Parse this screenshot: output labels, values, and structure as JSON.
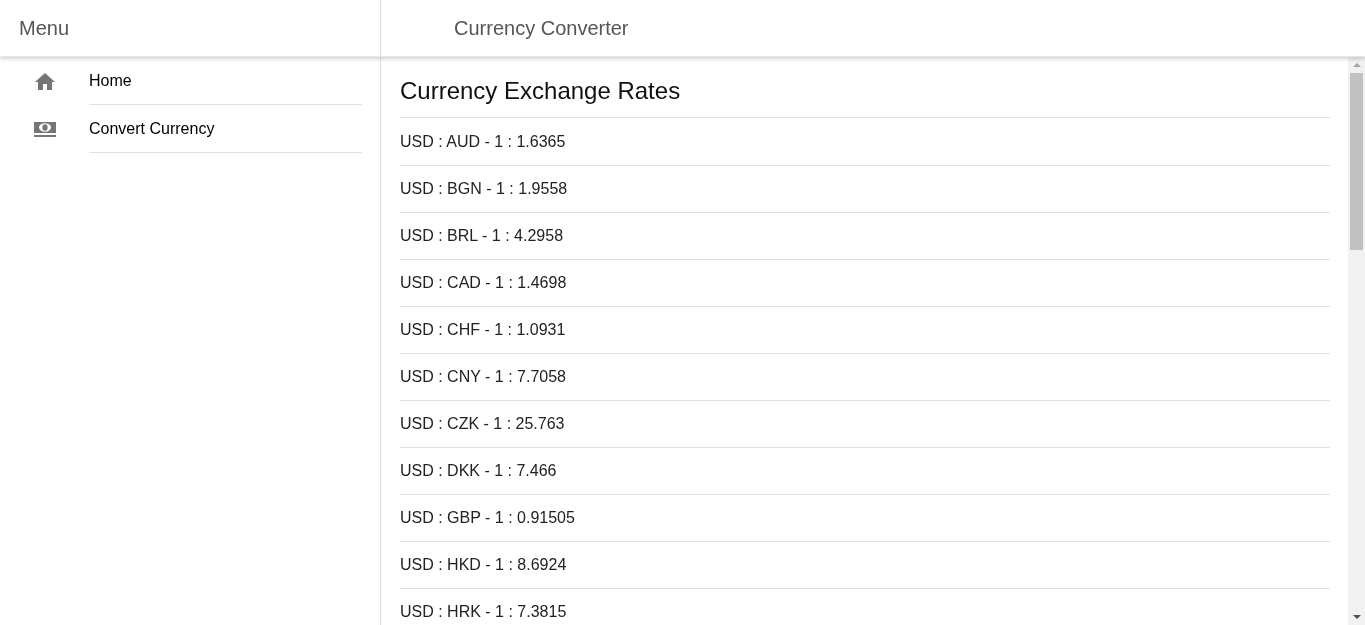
{
  "header": {
    "menu_title": "Menu",
    "title": "Currency Converter"
  },
  "sidebar": {
    "items": [
      {
        "label": "Home"
      },
      {
        "label": "Convert Currency"
      }
    ]
  },
  "main": {
    "title": "Currency Exchange Rates",
    "rates": [
      "USD : AUD - 1 : 1.6365",
      "USD : BGN - 1 : 1.9558",
      "USD : BRL - 1 : 4.2958",
      "USD : CAD - 1 : 1.4698",
      "USD : CHF - 1 : 1.0931",
      "USD : CNY - 1 : 7.7058",
      "USD : CZK - 1 : 25.763",
      "USD : DKK - 1 : 7.466",
      "USD : GBP - 1 : 0.91505",
      "USD : HKD - 1 : 8.6924",
      "USD : HRK - 1 : 7.3815"
    ]
  }
}
